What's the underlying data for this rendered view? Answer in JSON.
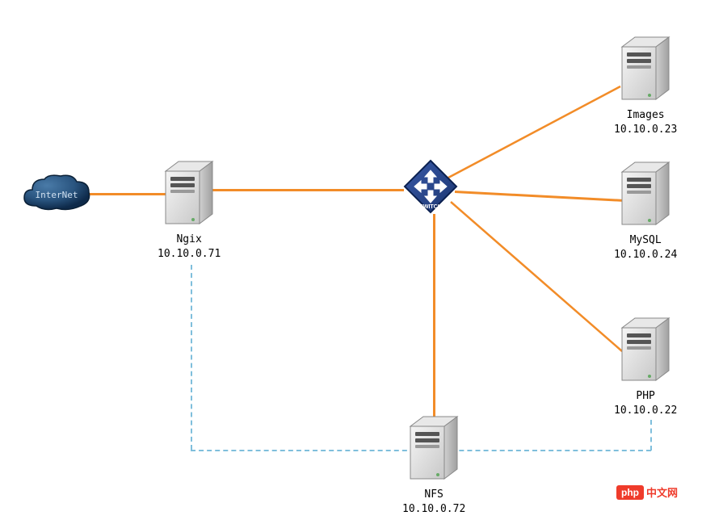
{
  "nodes": {
    "internet": {
      "label": "InterNet"
    },
    "nginx": {
      "label": "Ngix",
      "ip": "10.10.0.71"
    },
    "switch": {
      "label": "SWITCH"
    },
    "images": {
      "label": "Images",
      "ip": "10.10.0.23"
    },
    "mysql": {
      "label": "MySQL",
      "ip": "10.10.0.24"
    },
    "php": {
      "label": "PHP",
      "ip": "10.10.0.22"
    },
    "nfs": {
      "label": "NFS",
      "ip": "10.10.0.72"
    }
  },
  "watermark": {
    "logo": "php",
    "text": "中文网"
  }
}
